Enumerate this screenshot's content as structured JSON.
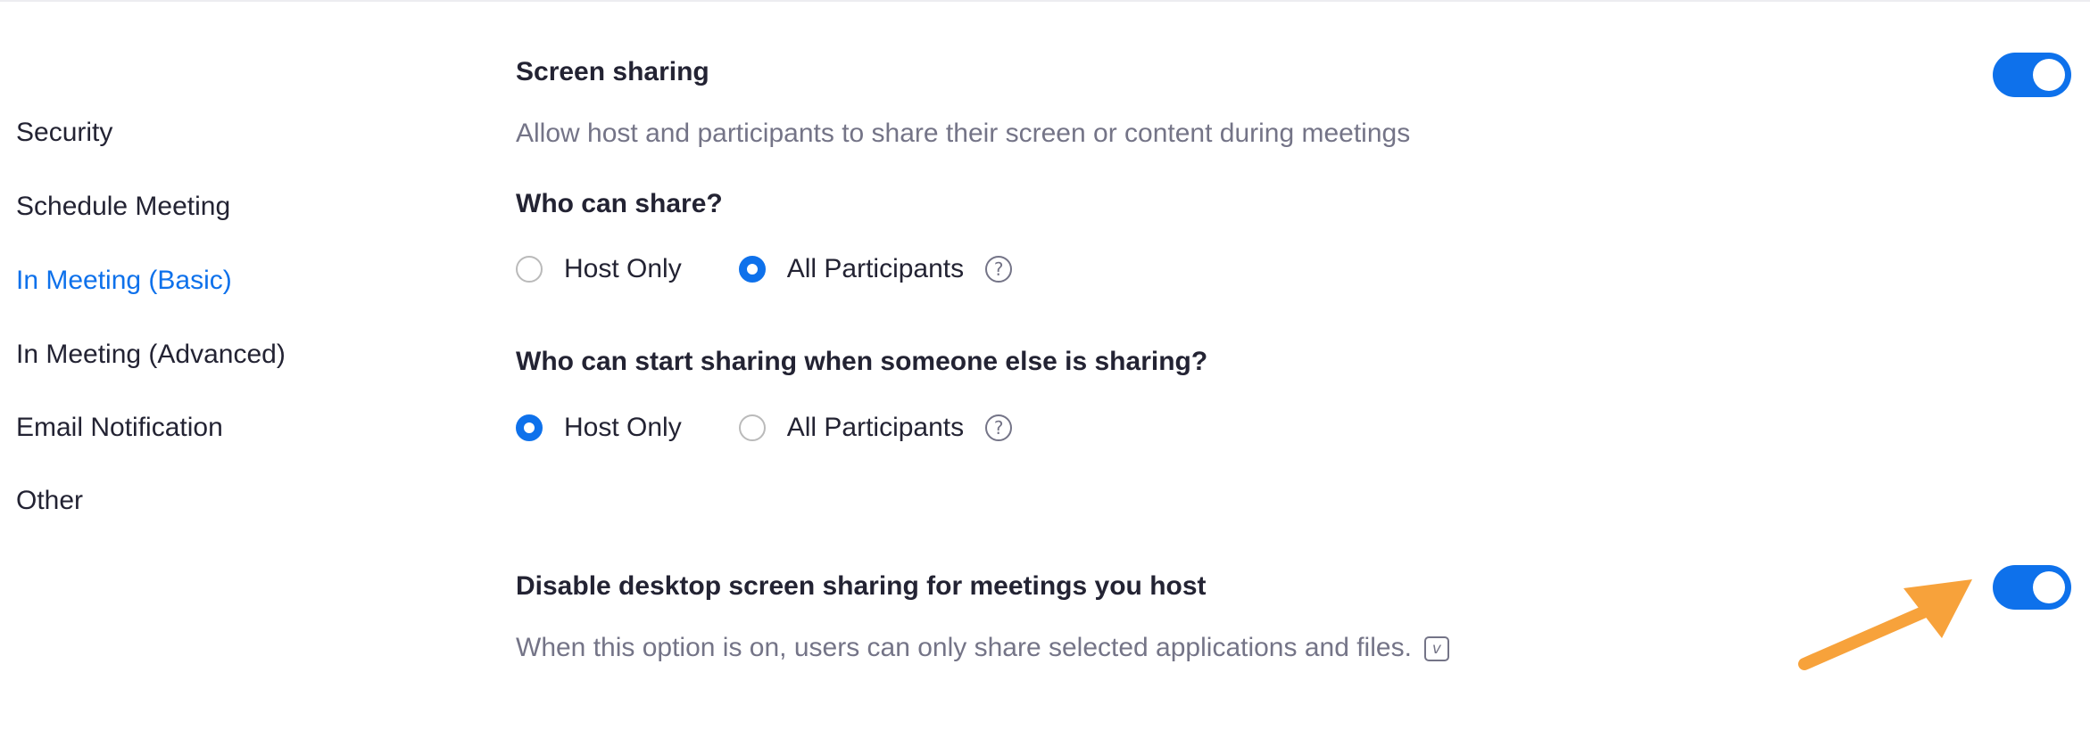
{
  "sidebar": {
    "items": [
      {
        "label": "Security"
      },
      {
        "label": "Schedule Meeting"
      },
      {
        "label": "In Meeting (Basic)"
      },
      {
        "label": "In Meeting (Advanced)"
      },
      {
        "label": "Email Notification"
      },
      {
        "label": "Other"
      }
    ],
    "active_index": 2
  },
  "screen_sharing": {
    "title": "Screen sharing",
    "description": "Allow host and participants to share their screen or content during meetings",
    "enabled": true,
    "who_can_share": {
      "question": "Who can share?",
      "options": [
        "Host Only",
        "All Participants"
      ],
      "selected": "All Participants"
    },
    "who_can_start": {
      "question": "Who can start sharing when someone else is sharing?",
      "options": [
        "Host Only",
        "All Participants"
      ],
      "selected": "Host Only"
    },
    "help_icon": "?"
  },
  "disable_desktop": {
    "title": "Disable desktop screen sharing for meetings you host",
    "description": "When this option is on, users can only share selected applications and files.",
    "enabled": true,
    "info_icon": "v"
  },
  "colors": {
    "accent": "#0e71eb",
    "arrow": "#f7a23b",
    "text": "#232333",
    "muted": "#747487"
  }
}
